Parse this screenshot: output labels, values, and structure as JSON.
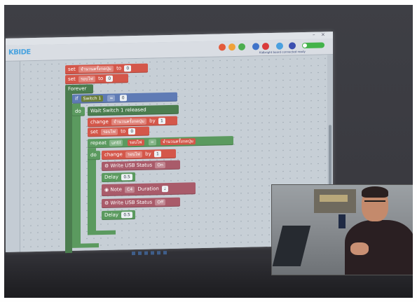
{
  "colors": {
    "variable_block": "#d4574a",
    "control_block": "#5b9a5f",
    "event_block": "#4b7d4f",
    "io_block": "#5f7bb5",
    "sound_block": "#a95b6a",
    "workspace": "#c7cfd6"
  },
  "app": {
    "logo": "KBIDE",
    "toolbar_caption": "Kidbright board connected ready"
  },
  "blocks": {
    "set1": {
      "keyword": "set",
      "var": "จำนวนครั้งกดปุ่ม",
      "to": "to",
      "value": "0"
    },
    "set2": {
      "keyword": "set",
      "var": "รอบไฟ",
      "to": "to",
      "value": "0"
    },
    "forever": "Forever",
    "if": {
      "keyword": "if",
      "switch": "Switch 1",
      "op": "=",
      "value": "0"
    },
    "do1": "do",
    "wait": "Wait Switch 1 released",
    "change1": {
      "keyword": "change",
      "var": "จำนวนครั้งกดปุ่ม",
      "by": "by",
      "value": "1"
    },
    "set3": {
      "keyword": "set",
      "var": "รอบไฟ",
      "to": "to",
      "value": "0"
    },
    "repeat": {
      "keyword": "repeat",
      "mode": "until",
      "var": "รอบไฟ",
      "op": "=",
      "target": "จำนวนครั้งกดปุ่ม"
    },
    "do2": "do",
    "change2": {
      "keyword": "change",
      "var": "รอบไฟ",
      "by": "by",
      "value": "1"
    },
    "usb1": {
      "label": "Write USB  Status",
      "state": "On"
    },
    "delay1": {
      "label": "Delay",
      "value": "0.5"
    },
    "note": {
      "label": "Note",
      "note": "C4",
      "duration_label": "Duration"
    },
    "usb2": {
      "label": "Write USB  Status",
      "state": "Off"
    },
    "delay2": {
      "label": "Delay",
      "value": "0.5"
    }
  }
}
